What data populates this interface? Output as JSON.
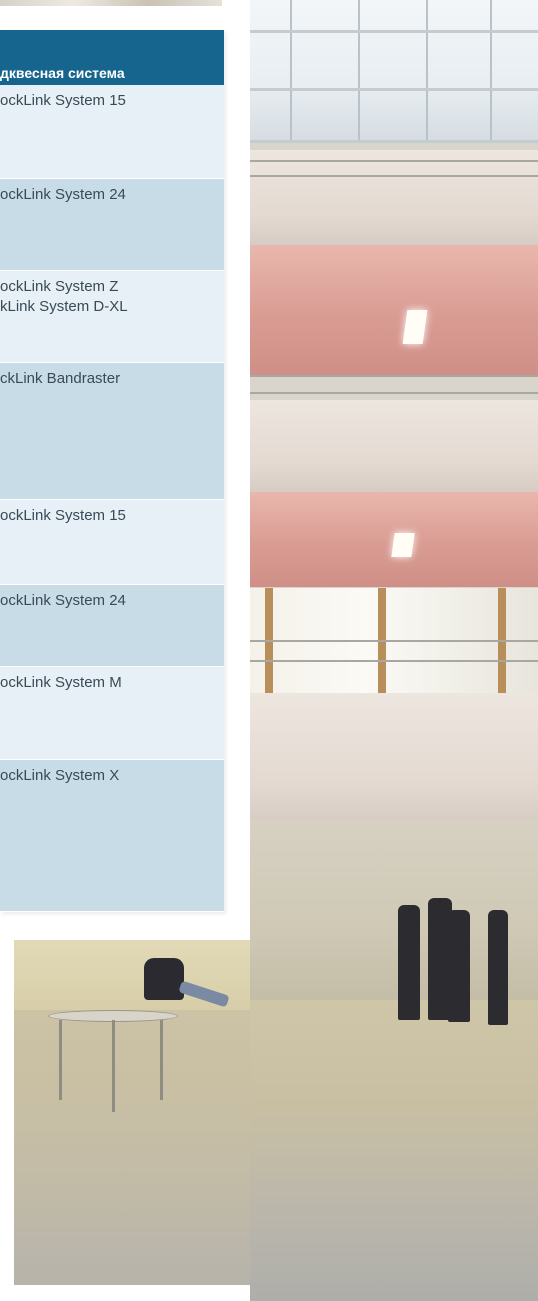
{
  "table": {
    "header": "дквесная система",
    "rows": [
      {
        "text": "ockLink System 15"
      },
      {
        "text": "ockLink System 24"
      },
      {
        "text": "ockLink System Z\nkLink System D-XL"
      },
      {
        "text": "ckLink Bandraster"
      },
      {
        "text": "ockLink System 15"
      },
      {
        "text": "ockLink System 24"
      },
      {
        "text": "ockLink System M"
      },
      {
        "text": "ockLink System X"
      }
    ]
  },
  "colors": {
    "header_bg": "#16658e",
    "row_light": "#e6f0f6",
    "row_dark": "#c8dce8",
    "text": "#3a4a55"
  }
}
